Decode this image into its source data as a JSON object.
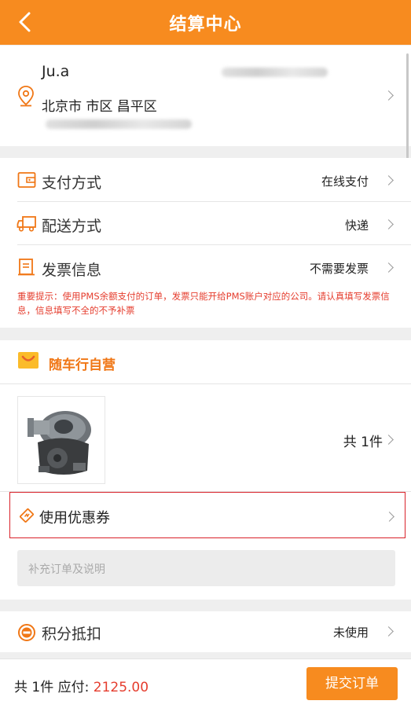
{
  "header": {
    "title": "结算中心"
  },
  "address": {
    "name": "Ju.a",
    "city_line": "北京市 市区 昌平区"
  },
  "payment": {
    "label": "支付方式",
    "value": "在线支付"
  },
  "delivery": {
    "label": "配送方式",
    "value": "快递"
  },
  "invoice": {
    "label": "发票信息",
    "value": "不需要发票",
    "notice": "重要提示：使用PMS余额支付的订单，发票只能开给PMS账户对应的公司。请认真填写发票信息，信息填写不全的不予补票"
  },
  "store": {
    "name": "随车行自营"
  },
  "goods": {
    "count_text": "共 1件"
  },
  "coupon": {
    "label": "使用优惠券"
  },
  "remark": {
    "placeholder": "补充订单及说明"
  },
  "points": {
    "label": "积分抵扣",
    "value": "未使用"
  },
  "footer": {
    "total_label": "共 1件 应付: ",
    "price": "2125.00",
    "submit_label": "提交订单"
  },
  "colors": {
    "brand": "#f78b1f",
    "alert_red": "#e53d2e",
    "highlight_border": "#d9222a"
  }
}
